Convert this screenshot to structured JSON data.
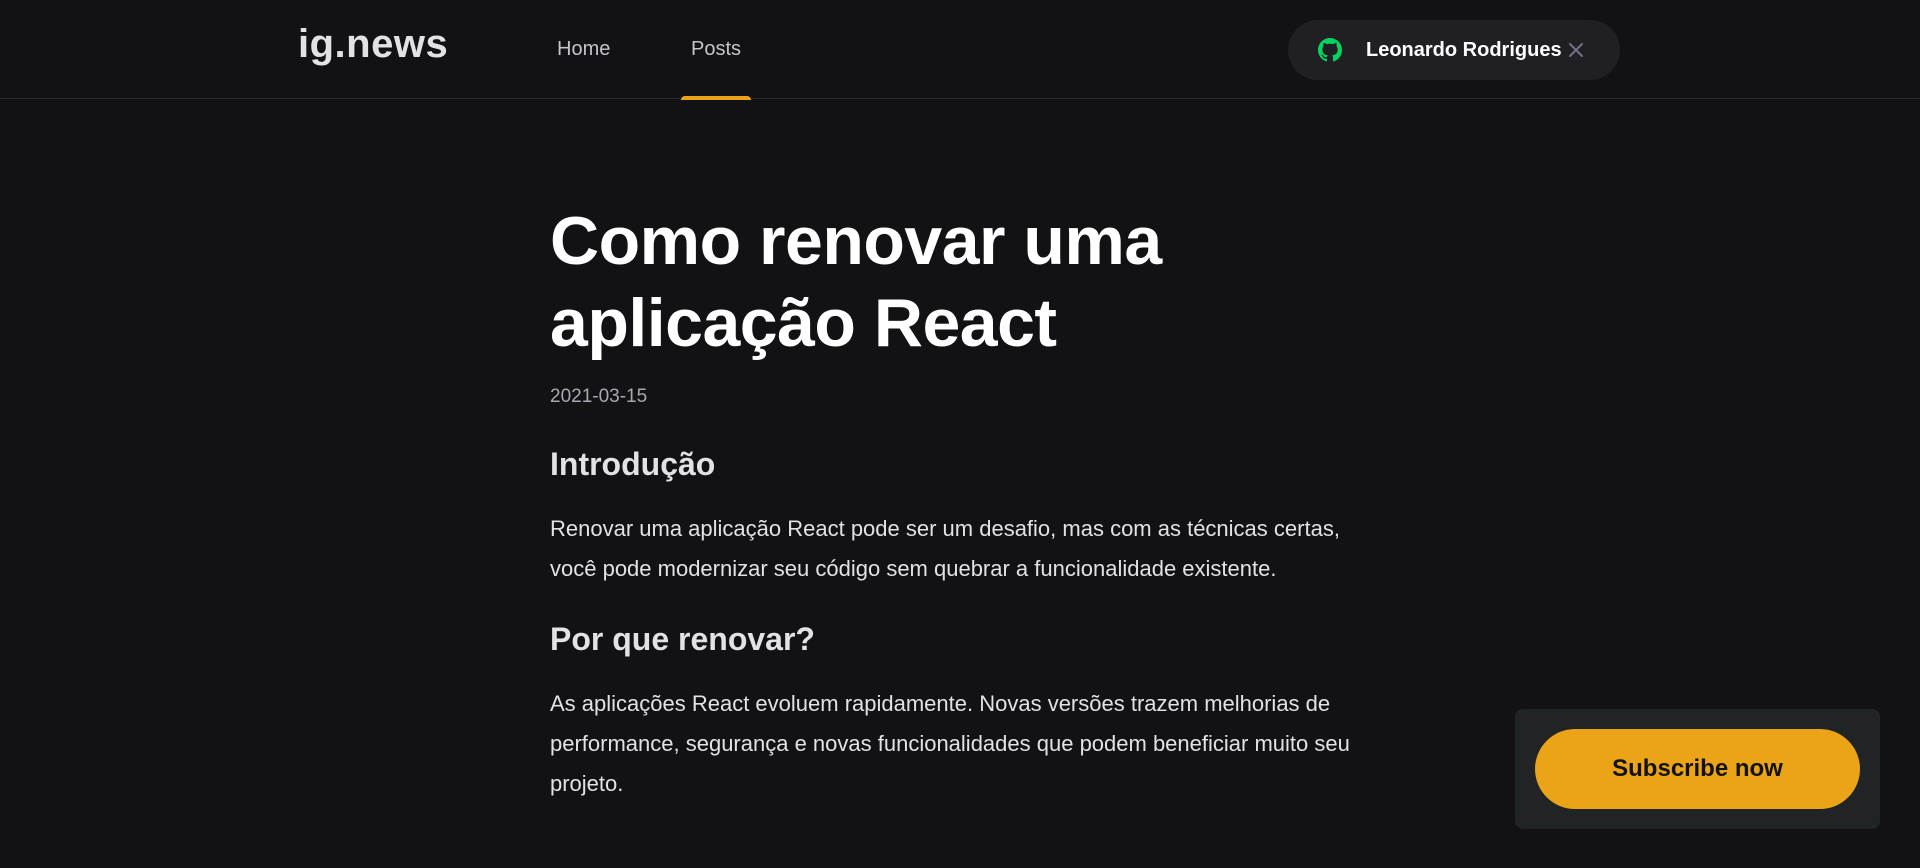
{
  "header": {
    "logo": "ig.news",
    "nav": {
      "home": "Home",
      "posts": "Posts"
    },
    "active_nav": "posts",
    "user": {
      "name": "Leonardo Rodrigues",
      "icon": "github-icon",
      "close_icon": "close-icon"
    }
  },
  "article": {
    "title_line1": "Como renovar uma",
    "title_line2": "aplicação React",
    "date": "2021-03-15",
    "sections": [
      {
        "heading": "Introdução",
        "text": "Renovar uma aplicação React pode ser um desafio, mas com as técnicas certas, você pode modernizar seu código sem quebrar a funcionalidade existente."
      },
      {
        "heading": "Por que renovar?",
        "text": "As aplicações React evoluem rapidamente. Novas versões trazem melhorias de performance, segurança e novas funcionalidades que podem beneficiar muito seu projeto."
      }
    ]
  },
  "subscribe": {
    "label": "Subscribe now"
  },
  "colors": {
    "background": "#121214",
    "accent": "#eba417",
    "pill_background": "#202024",
    "github_green": "#04d361"
  }
}
